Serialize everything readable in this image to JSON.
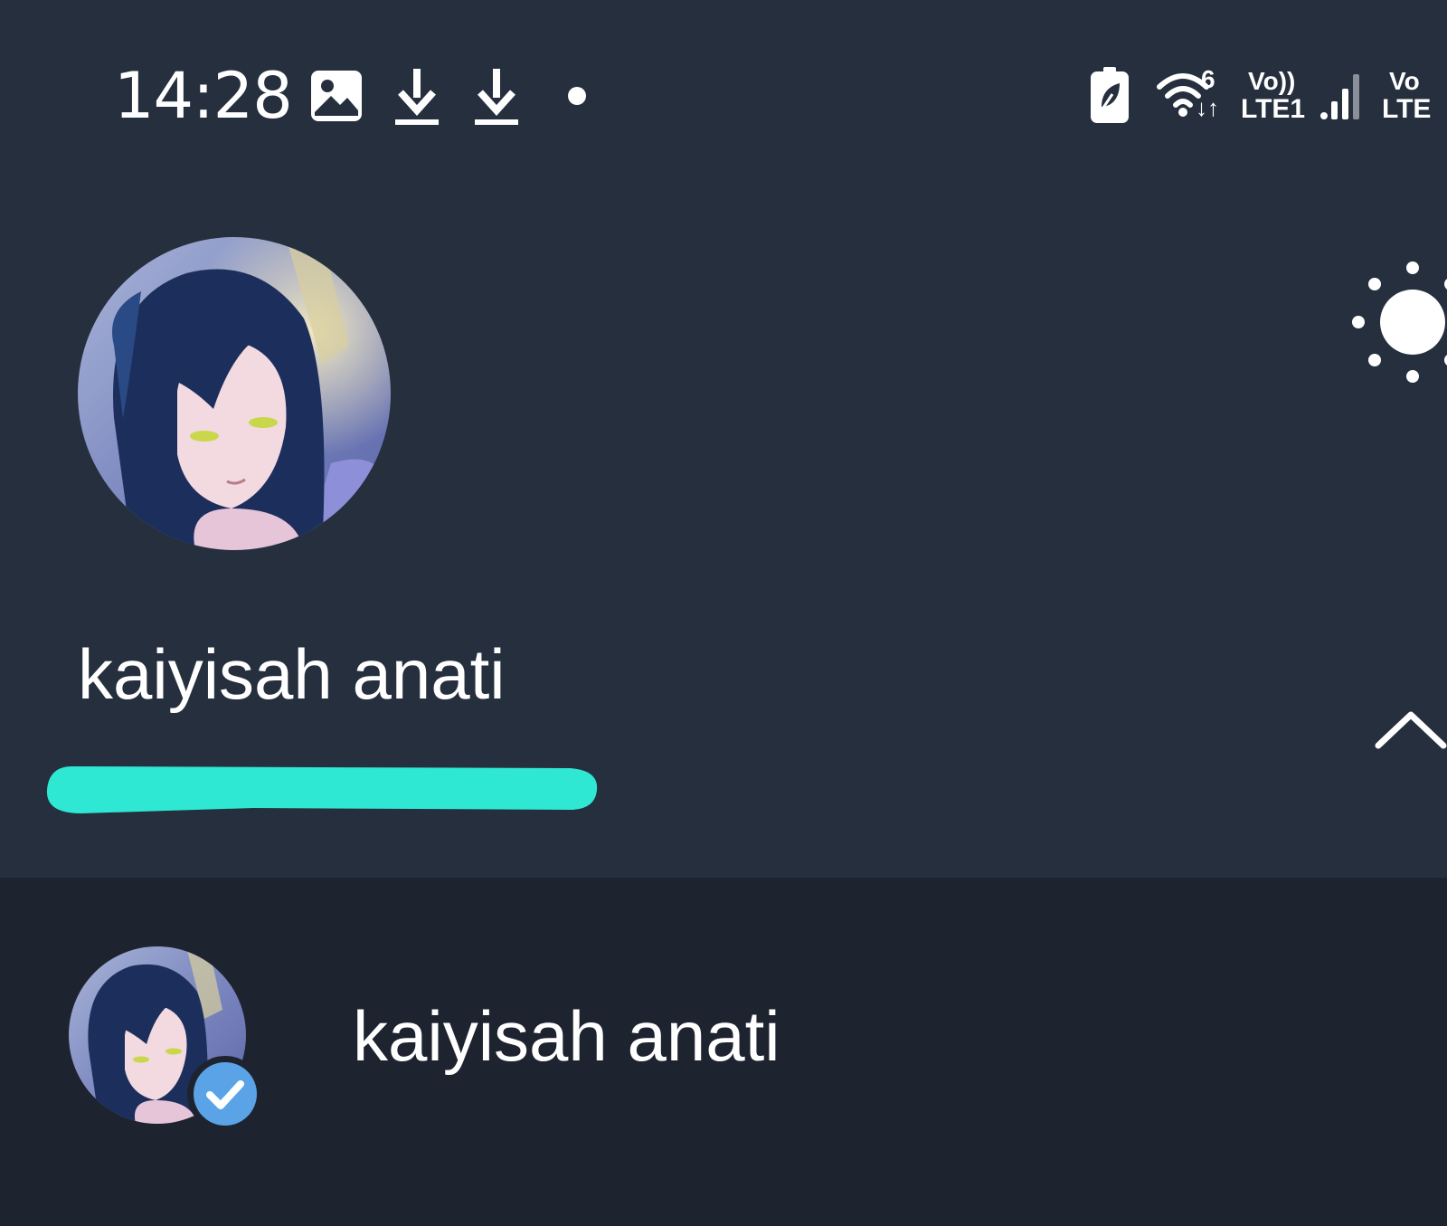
{
  "status_bar": {
    "time": "14:28",
    "icons": [
      "gallery-icon",
      "download-icon",
      "download-icon",
      "dot-icon",
      "battery-saver-icon",
      "wifi-icon",
      "signal-icon"
    ],
    "wifi_badge": "6",
    "sim1_volte": "Vo))",
    "sim1_network": "LTE1",
    "sim2_volte": "Vo",
    "sim2_network": "LTE"
  },
  "profile": {
    "name": "kaiyisah anati",
    "theme_toggle_icon": "sun-icon",
    "collapse_icon": "chevron-up-icon"
  },
  "accounts": [
    {
      "name": "kaiyisah anati",
      "verified": true
    }
  ],
  "colors": {
    "header_bg": "#262f3e",
    "list_bg": "#1e2330",
    "redaction": "#2ee8d4",
    "verified": "#5aa3e6"
  }
}
